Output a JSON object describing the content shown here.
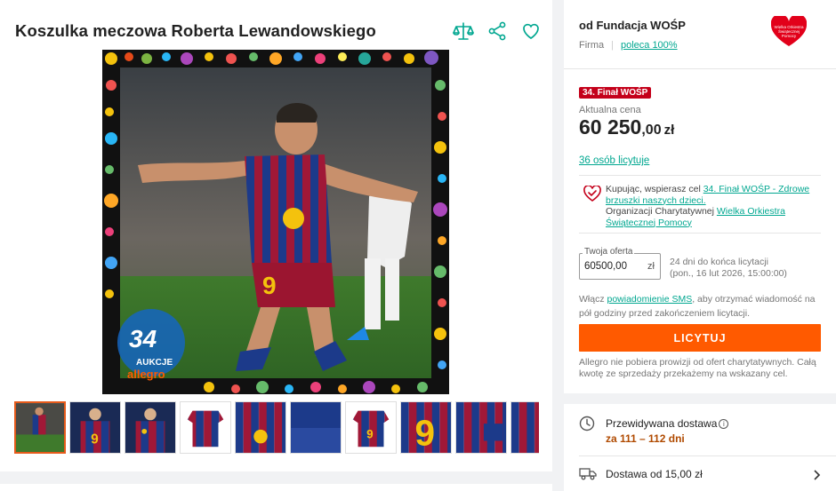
{
  "product": {
    "title": "Koszulka meczowa Roberta Lewandowskiego",
    "jersey_number": "9",
    "watermark_line1": "34",
    "watermark_line2": "AUKCJE",
    "watermark_line3": "allegro"
  },
  "top_icons": [
    {
      "name": "compare-icon"
    },
    {
      "name": "share-icon"
    },
    {
      "name": "favorite-icon"
    }
  ],
  "thumbnails": [
    {
      "name": "thumbnail-1",
      "active": true
    },
    {
      "name": "thumbnail-2"
    },
    {
      "name": "thumbnail-3"
    },
    {
      "name": "thumbnail-4"
    },
    {
      "name": "thumbnail-5"
    },
    {
      "name": "thumbnail-6"
    },
    {
      "name": "thumbnail-7"
    },
    {
      "name": "thumbnail-8"
    },
    {
      "name": "thumbnail-9"
    },
    {
      "name": "thumbnail-10"
    }
  ],
  "seller": {
    "name": "od Fundacja WOŚP",
    "type": "Firma",
    "rating": "poleca 100%",
    "logo_text": "Wielka Orkiestra Świątecznej Pomocy"
  },
  "auction": {
    "badge": "34. Finał WOŚP",
    "price_label": "Aktualna cena",
    "price_int": "60 250",
    "price_dec": ",00",
    "currency": "zł",
    "bidders": "36 osób licytuje"
  },
  "support": {
    "text1": "Kupując, wspierasz cel ",
    "goal_link": "34. Finał WOŚP - Zdrowe brzuszki naszych dzieci.",
    "text2": "Organizacji Charytatywnej ",
    "org_link": "Wielka Orkiestra Świątecznej Pomocy"
  },
  "offer": {
    "label": "Twoja oferta",
    "value": "60500,00",
    "currency": "zł",
    "deadline_line1": "24 dni do końca licytacji",
    "deadline_line2": "(pon., 16 lut 2026, 15:00:00)"
  },
  "sms": {
    "text1": "Włącz ",
    "link": "powiadomienie SMS",
    "text2": ", aby otrzymać wiadomość na pół godziny przed zakończeniem licytacji."
  },
  "bid_button": "LICYTUJ",
  "note": "Allegro nie pobiera prowizji od ofert charytatywnych. Całą kwotę ze sprzedaży przekażemy na wskazany cel.",
  "shipping": {
    "expected_label": "Przewidywana dostawa",
    "expected_value": "za 111 – 112 dni",
    "info_icon": "i",
    "delivery_label": "Dostawa od 15,00 zł"
  },
  "colors": {
    "accent": "#ff5a00",
    "link": "#00a790",
    "badge": "#c4001a",
    "delivery_date": "#b04a00"
  }
}
